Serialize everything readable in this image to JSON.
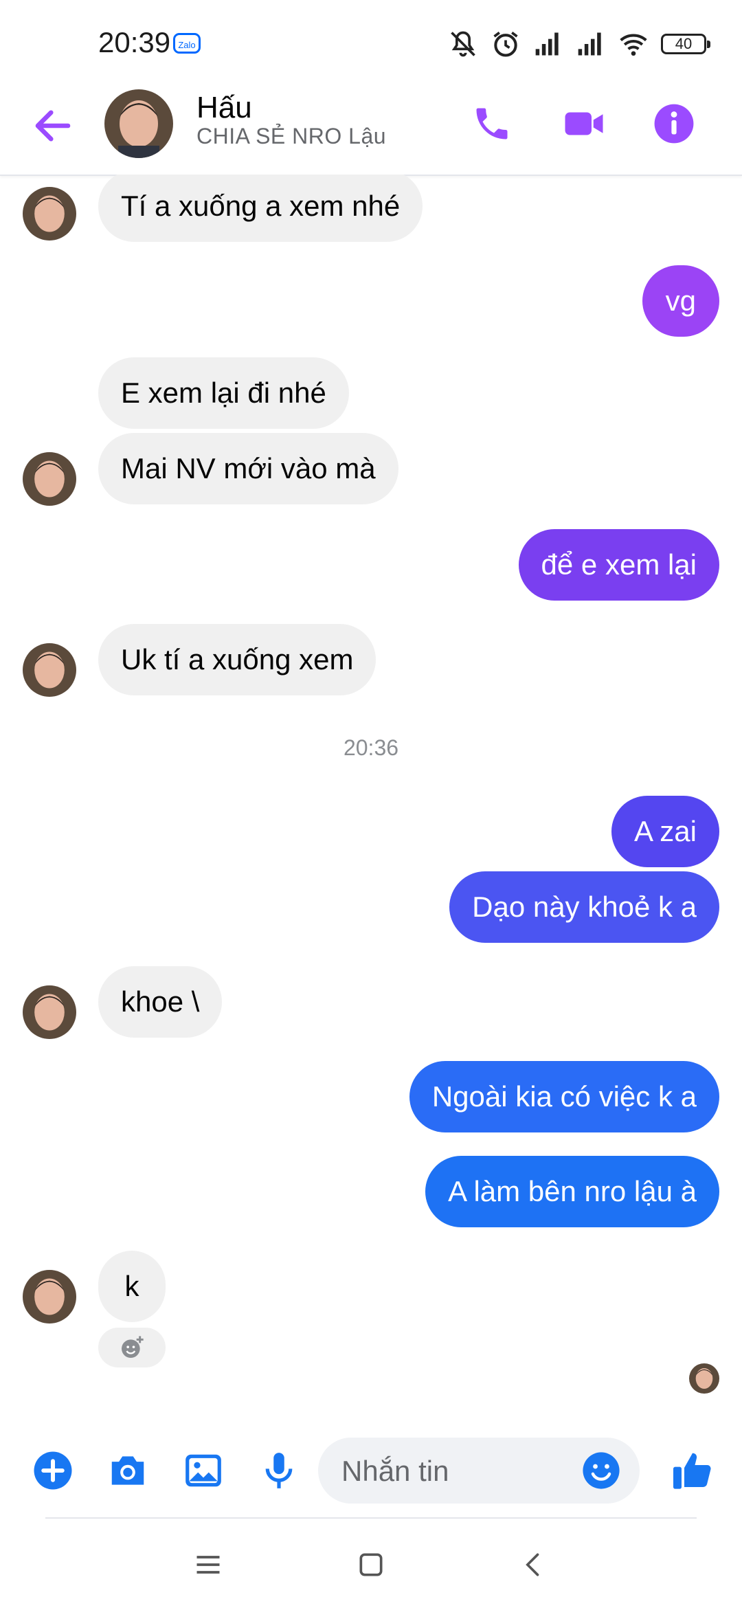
{
  "status_bar": {
    "time": "20:39",
    "zalo_label": "Zalo",
    "battery": "40"
  },
  "header": {
    "name": "Hấu",
    "subtitle": "CHIA SẺ NRO Lậu"
  },
  "messages": [
    {
      "side": "in",
      "text": "Tí a xuống a xem nhé"
    },
    {
      "side": "out",
      "text": "vg"
    },
    {
      "side": "in",
      "text": "E xem lại đi nhé"
    },
    {
      "side": "in",
      "text": "Mai NV mới vào mà"
    },
    {
      "side": "out",
      "text": "để e xem lại"
    },
    {
      "side": "in",
      "text": "Uk tí a xuống xem"
    },
    {
      "side": "out",
      "text": "A zai"
    },
    {
      "side": "out",
      "text": "Dạo này khoẻ k a"
    },
    {
      "side": "in",
      "text": "khoe \\"
    },
    {
      "side": "out",
      "text": "Ngoài kia có việc k a"
    },
    {
      "side": "out",
      "text": "A làm bên nro lậu à"
    },
    {
      "side": "in",
      "text": "k"
    }
  ],
  "timestamp": "20:36",
  "composer": {
    "placeholder": "Nhắn tin"
  },
  "colors": {
    "accent": "#9b4bff",
    "messenger_blue": "#1877f2",
    "incoming_bg": "#f0f0f0"
  }
}
